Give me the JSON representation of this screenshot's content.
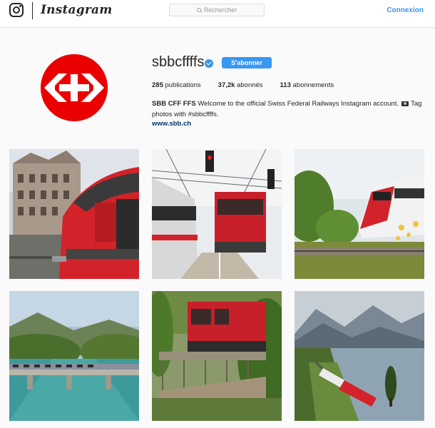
{
  "header": {
    "wordmark": "Instagram",
    "search_placeholder": "Rechercher",
    "login_label": "Connexion"
  },
  "profile": {
    "username": "sbbcffffs",
    "follow_label": "S'abonner",
    "stats": {
      "posts_count": "285",
      "posts_label": "publications",
      "followers_count": "37,2k",
      "followers_label": "abonnés",
      "following_count": "113",
      "following_label": "abonnements"
    },
    "bio_name": "SBB CFF FFS",
    "bio_text_1": "Welcome to the official Swiss Federal Railways Instagram account.",
    "bio_text_2": "Tag photos with #sbbcffffs.",
    "website": "www.sbb.ch"
  },
  "icons": {
    "logo": "instagram-camera-icon",
    "search": "search-icon",
    "verified": "verified-badge-icon",
    "bio_emoji": "camera-icon"
  },
  "colors": {
    "accent": "#3897f0",
    "brand_red": "#eb0000",
    "link": "#003569"
  },
  "posts": [
    {
      "subject": "red train front near old building"
    },
    {
      "subject": "two trains in station with signals"
    },
    {
      "subject": "red and white train in countryside"
    },
    {
      "subject": "train crossing river bridge"
    },
    {
      "subject": "red locomotive on bridge"
    },
    {
      "subject": "red train along lake shore"
    }
  ]
}
